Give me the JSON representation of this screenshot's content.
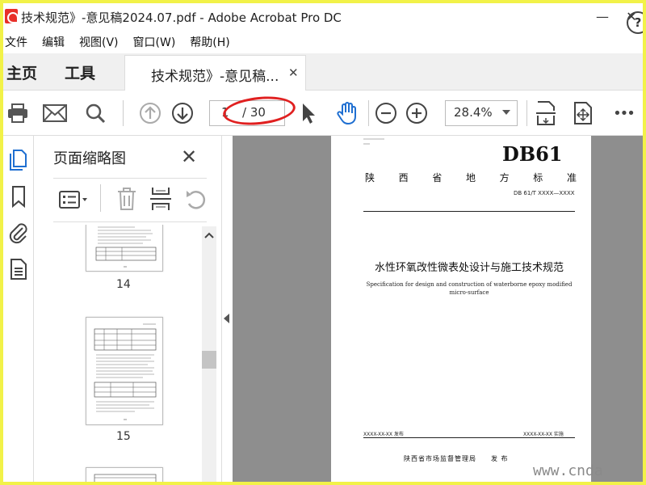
{
  "window": {
    "title": "技术规范》-意见稿2024.07.pdf - Adobe Acrobat Pro DC",
    "minimize": "—",
    "close": "✕"
  },
  "menu": [
    "文件",
    "编辑",
    "视图(V)",
    "窗口(W)",
    "帮助(H)"
  ],
  "tabs": {
    "home": "主页",
    "tools": "工具",
    "document": "技术规范》-意见稿...",
    "document_close": "✕",
    "help": "?"
  },
  "toolbar": {
    "page_current": "1",
    "page_total": "/ 30",
    "zoom": "28.4%",
    "more": "•••"
  },
  "thumbnail_panel": {
    "title": "页面缩略图",
    "close": "✕",
    "pages": [
      {
        "number": "14"
      },
      {
        "number": "15"
      }
    ]
  },
  "document_page": {
    "code": "DB61",
    "province": [
      "陕",
      "西",
      "省",
      "地",
      "方",
      "标",
      "准"
    ],
    "standard_number": "DB 61/T XXXX—XXXX",
    "title_cn": "水性环氧改性微表处设计与施工技术规范",
    "title_en_line1": "Specification for design and construction of waterborne epoxy modified",
    "title_en_line2": "micro-surface",
    "issue_date": "XXXX-XX-XX 发布",
    "implement_date": "XXXX-XX-XX 实施",
    "issuer": "陕西省市场监督管理局　　发 布"
  },
  "watermark": "www.cnda",
  "colors": {
    "border": "#f2f248",
    "red_annotation": "#e02020",
    "hand_tool": "#1f6fd1"
  }
}
